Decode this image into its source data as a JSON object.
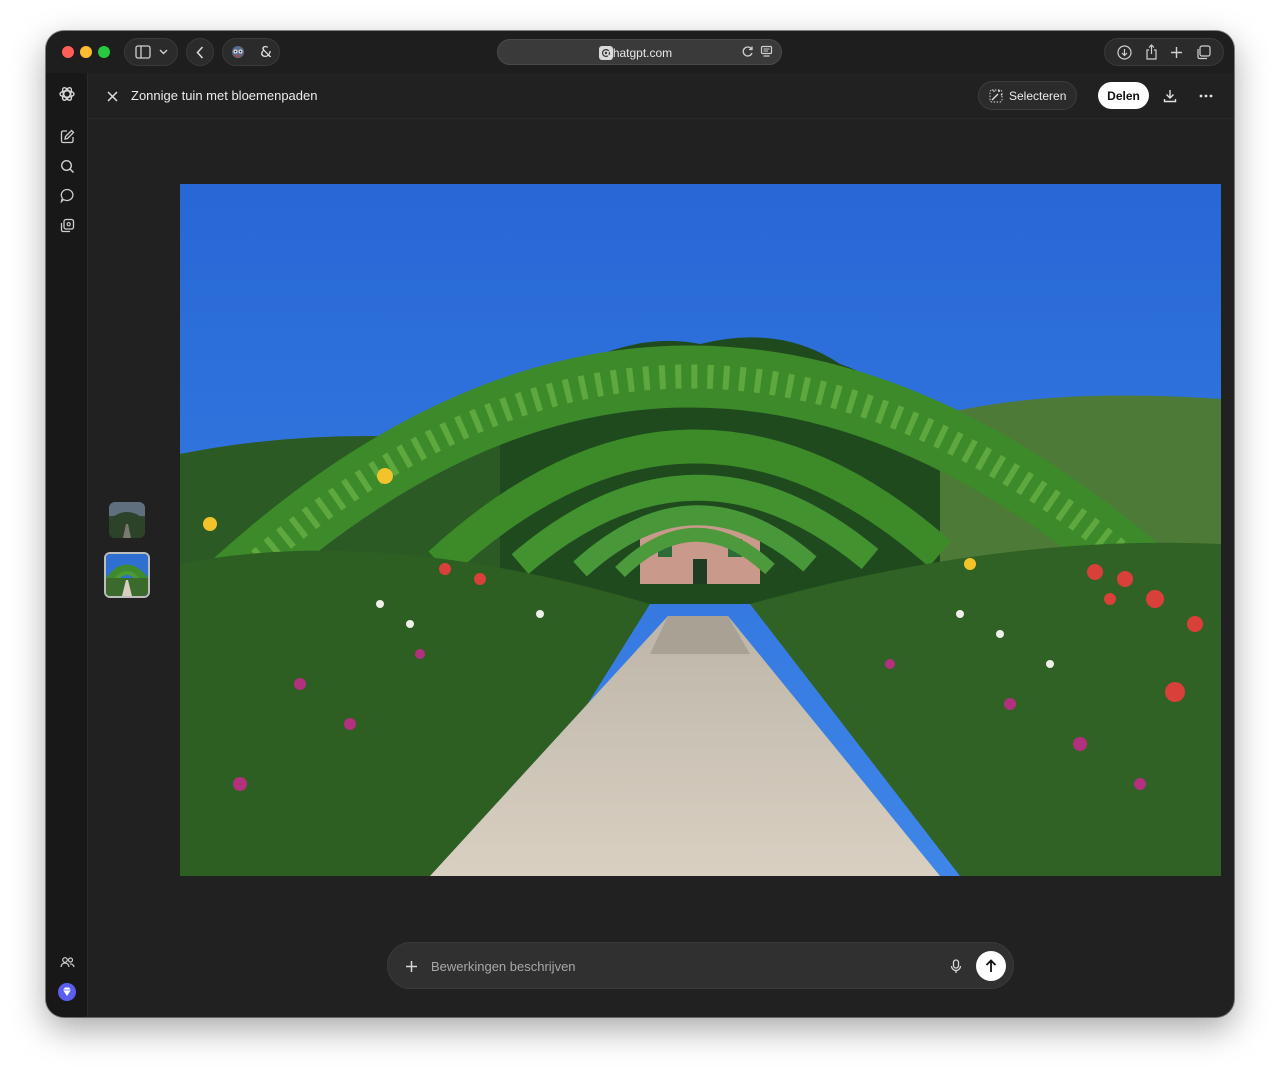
{
  "browser": {
    "url": "chatgpt.com",
    "icons": [
      "sidebar-icon",
      "chevron-down-icon",
      "back-icon",
      "extension-icon",
      "ampersand-icon",
      "reload-icon",
      "reader-icon",
      "download-icon",
      "share-icon",
      "new-tab-icon",
      "tabs-icon"
    ]
  },
  "rail": {
    "icons": [
      "openai-logo-icon",
      "new-chat-icon",
      "search-icon",
      "chat-icon",
      "library-icon",
      "people-icon",
      "upgrade-icon"
    ],
    "accent": "#5b5ef0"
  },
  "header": {
    "title": "Zonnige tuin met bloemenpaden",
    "select_label": "Selecteren",
    "share_label": "Delen"
  },
  "gallery": {
    "thumbnail_count": 2,
    "selected_index": 1
  },
  "composer": {
    "placeholder": "Bewerkingen beschrijven",
    "value": ""
  },
  "colors": {
    "background": "#212121",
    "rail": "#181818",
    "composer": "#303030",
    "share_button": "#ffffff"
  }
}
